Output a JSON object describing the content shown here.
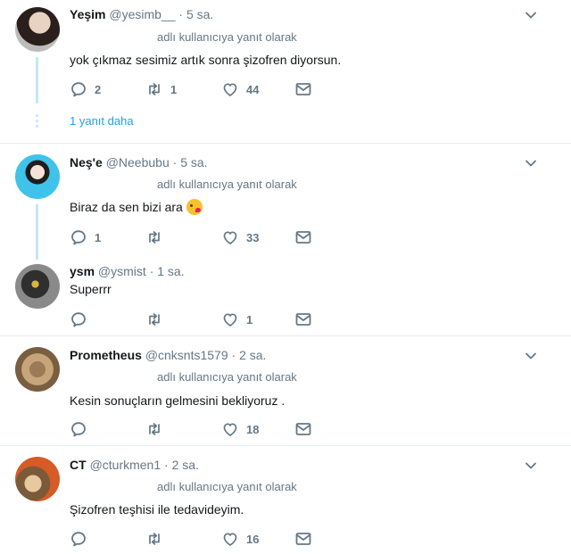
{
  "tweets": [
    {
      "name": "Yeşim",
      "handle": "@yesimb__",
      "time": "5 sa.",
      "reply": "adlı kullanıcıya yanıt olarak",
      "text": "yok çıkmaz sesimiz artık sonra şizofren diyorsun.",
      "replies": "2",
      "retweets": "1",
      "likes": "44",
      "more_replies": "1 yanıt daha"
    },
    {
      "name": "Neş'e",
      "handle": "@Neebubu",
      "time": "5 sa.",
      "reply": "adlı kullanıcıya yanıt olarak",
      "text": "Biraz da sen bizi ara",
      "replies": "1",
      "retweets": "",
      "likes": "33"
    },
    {
      "name": "ysm",
      "handle": "@ysmist",
      "time": "1 sa.",
      "text": "Superrr",
      "replies": "",
      "retweets": "",
      "likes": "1"
    },
    {
      "name": "Prometheus",
      "handle": "@cnksnts1579",
      "time": "2 sa.",
      "reply": "adlı kullanıcıya yanıt olarak",
      "text": "Kesin sonuçların gelmesini bekliyoruz .",
      "replies": "",
      "retweets": "",
      "likes": "18"
    },
    {
      "name": "CT",
      "handle": "@cturkmen1",
      "time": "2 sa.",
      "reply": "adlı kullanıcıya yanıt olarak",
      "text": "Şizofren teşhisi ile tedavideyim.",
      "replies": "",
      "retweets": "",
      "likes": "16"
    }
  ],
  "separator": "·",
  "colors": {
    "accent": "#1da1f2",
    "muted": "#657786",
    "thread": "#c4e7f9"
  },
  "icons": [
    "reply-icon",
    "retweet-icon",
    "like-icon",
    "direct-message-icon",
    "chevron-down-icon",
    "kiss-emoji-icon"
  ]
}
